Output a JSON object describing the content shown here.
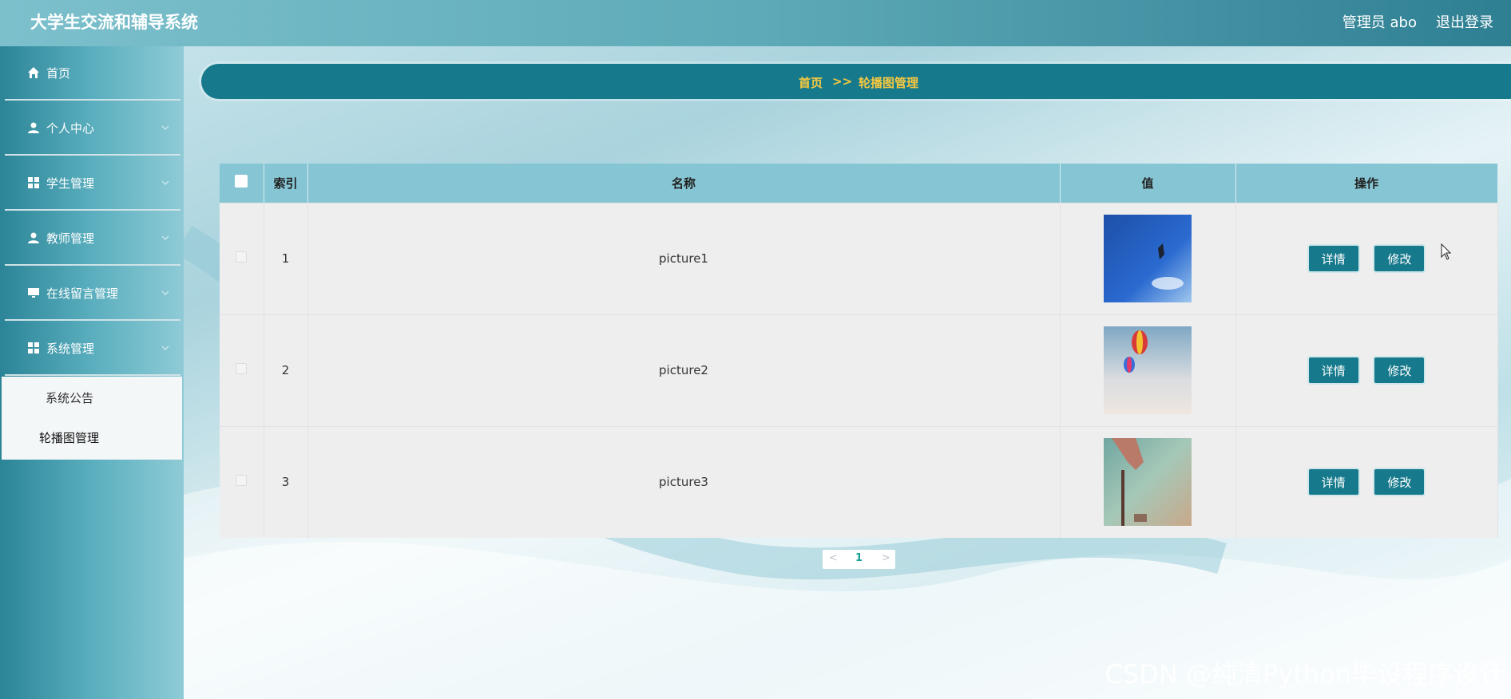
{
  "header": {
    "app_title": "大学生交流和辅导系统",
    "user_label": "管理员 abo",
    "logout_label": "退出登录"
  },
  "sidebar": {
    "items": [
      {
        "label": "首页",
        "icon": "home-icon"
      },
      {
        "label": "个人中心",
        "icon": "user-icon"
      },
      {
        "label": "学生管理",
        "icon": "grid-icon"
      },
      {
        "label": "教师管理",
        "icon": "user-icon"
      },
      {
        "label": "在线留言管理",
        "icon": "monitor-icon"
      },
      {
        "label": "系统管理",
        "icon": "grid-icon"
      }
    ],
    "submenu": [
      {
        "label": "系统公告"
      },
      {
        "label": "轮播图管理"
      }
    ]
  },
  "breadcrumb": {
    "home": "首页",
    "separator": ">>",
    "current": "轮播图管理"
  },
  "table": {
    "headers": [
      "索引",
      "名称",
      "值",
      "操作"
    ],
    "rows": [
      {
        "index": "1",
        "name": "picture1",
        "thumb": "sky-blue-image"
      },
      {
        "index": "2",
        "name": "picture2",
        "thumb": "hot-air-balloon-image"
      },
      {
        "index": "3",
        "name": "picture3",
        "thumb": "beach-hand-image"
      }
    ],
    "detail_label": "详情",
    "edit_label": "修改"
  },
  "pagination": {
    "prev": "<",
    "page": "1",
    "next": ">"
  },
  "watermark": "CSDN @纯清Python毕设程序设计",
  "colors": {
    "accent": "#177a8c",
    "breadcrumb_text": "#f7c940",
    "table_header": "#86c6d4"
  }
}
